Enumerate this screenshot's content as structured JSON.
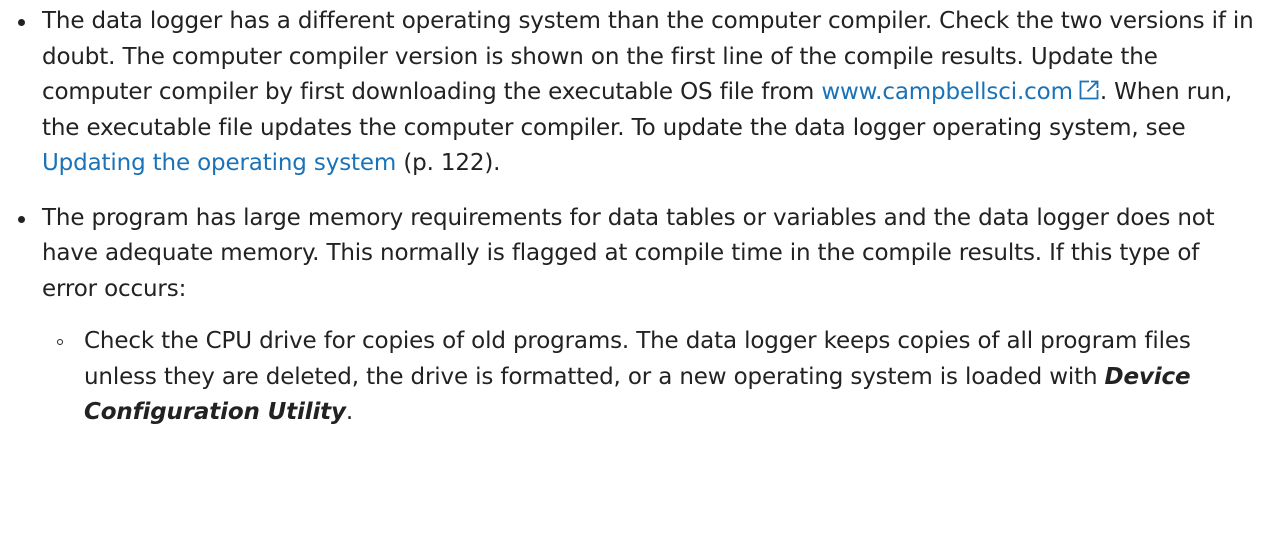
{
  "bullets": [
    {
      "part1": "The data logger has a different operating system than the computer compiler. Check the two versions if in doubt. The computer compiler version is shown on the first line of the compile results. Update the computer compiler by first downloading the executable OS file from ",
      "link_text": "www.campbellsci.com",
      "external_link_icon": "external-link-icon",
      "part2": ". When run, the executable file updates the computer compiler. To update the data logger operating system, see ",
      "xref_text": "Updating the operating system",
      "page_ref": " (p. 122)."
    },
    {
      "text": "The program has large memory requirements for data tables or variables and the data logger does not have adequate memory. This normally is flagged at compile time in the compile results. If this type of error occurs:",
      "subitems": [
        {
          "text": "Check the CPU drive for copies of old programs. The data logger keeps copies of all program files unless they are deleted, the drive is formatted, or a new operating system is loaded with ",
          "emphasis": "Device Configuration Utility",
          "end": "."
        }
      ]
    }
  ],
  "colors": {
    "text": "#222222",
    "link": "#1a73b8"
  }
}
